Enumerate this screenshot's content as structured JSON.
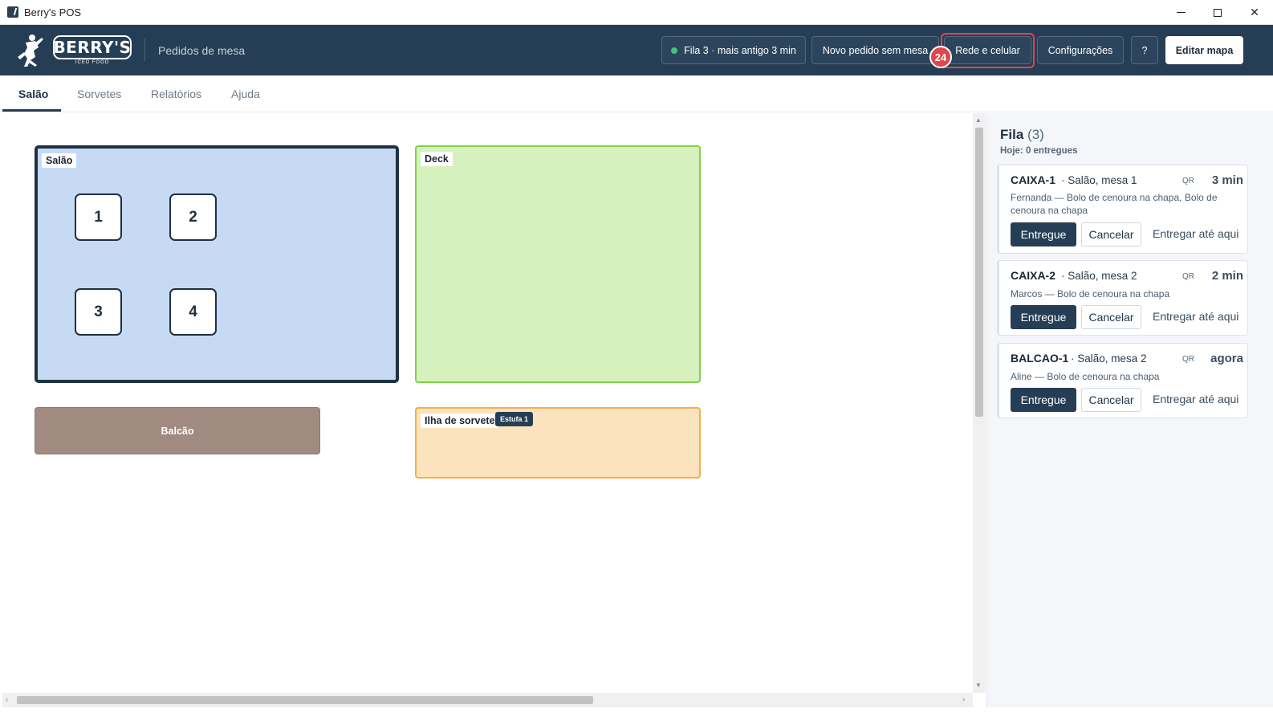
{
  "window": {
    "title": "Berry's POS"
  },
  "header": {
    "logo_text": "BERRY'S",
    "logo_sub": "ICED FOOD",
    "page_title": "Pedidos de mesa",
    "queue_status": "Fila 3 · mais antigo 3 min",
    "new_order": "Novo pedido sem mesa",
    "network": "Rede e celular",
    "network_badge": "24",
    "settings": "Configurações",
    "help": "?",
    "edit_map": "Editar mapa",
    "colors": {
      "bg": "#263e55",
      "status_dot": "#3fc47a",
      "highlight": "#e0464c"
    }
  },
  "tabs": [
    {
      "label": "Salão",
      "active": true
    },
    {
      "label": "Sorvetes",
      "active": false
    },
    {
      "label": "Relatórios",
      "active": false
    },
    {
      "label": "Ajuda",
      "active": false
    }
  ],
  "map": {
    "zones": {
      "salao": {
        "label": "Salão",
        "tables": [
          "1",
          "2",
          "3",
          "4"
        ]
      },
      "deck": {
        "label": "Deck"
      },
      "balcao": {
        "label": "Balcão"
      },
      "ilha": {
        "label": "Ilha de sorvete",
        "badge": "Estufa 1"
      }
    }
  },
  "queue": {
    "title": "Fila",
    "count": "(3)",
    "subtitle": "Hoje: 0 entregues",
    "orders": [
      {
        "code": "CAIXA-1",
        "location": "Salão, mesa 1",
        "source": "QR",
        "time": "3 min",
        "customer": "Fernanda",
        "items": "Bolo de cenoura na chapa, Bolo de cenoura na chapa",
        "deliver": "Entregue",
        "cancel": "Cancelar",
        "deliver_until": "Entregar até aqui"
      },
      {
        "code": "CAIXA-2",
        "location": "Salão, mesa 2",
        "source": "QR",
        "time": "2 min",
        "customer": "Marcos",
        "items": "Bolo de cenoura na chapa",
        "deliver": "Entregue",
        "cancel": "Cancelar",
        "deliver_until": "Entregar até aqui"
      },
      {
        "code": "BALCAO-1",
        "location": "Salão, mesa 2",
        "source": "QR",
        "time": "agora",
        "customer": "Aline",
        "items": "Bolo de cenoura na chapa",
        "deliver": "Entregue",
        "cancel": "Cancelar",
        "deliver_until": "Entregar até aqui"
      }
    ]
  }
}
